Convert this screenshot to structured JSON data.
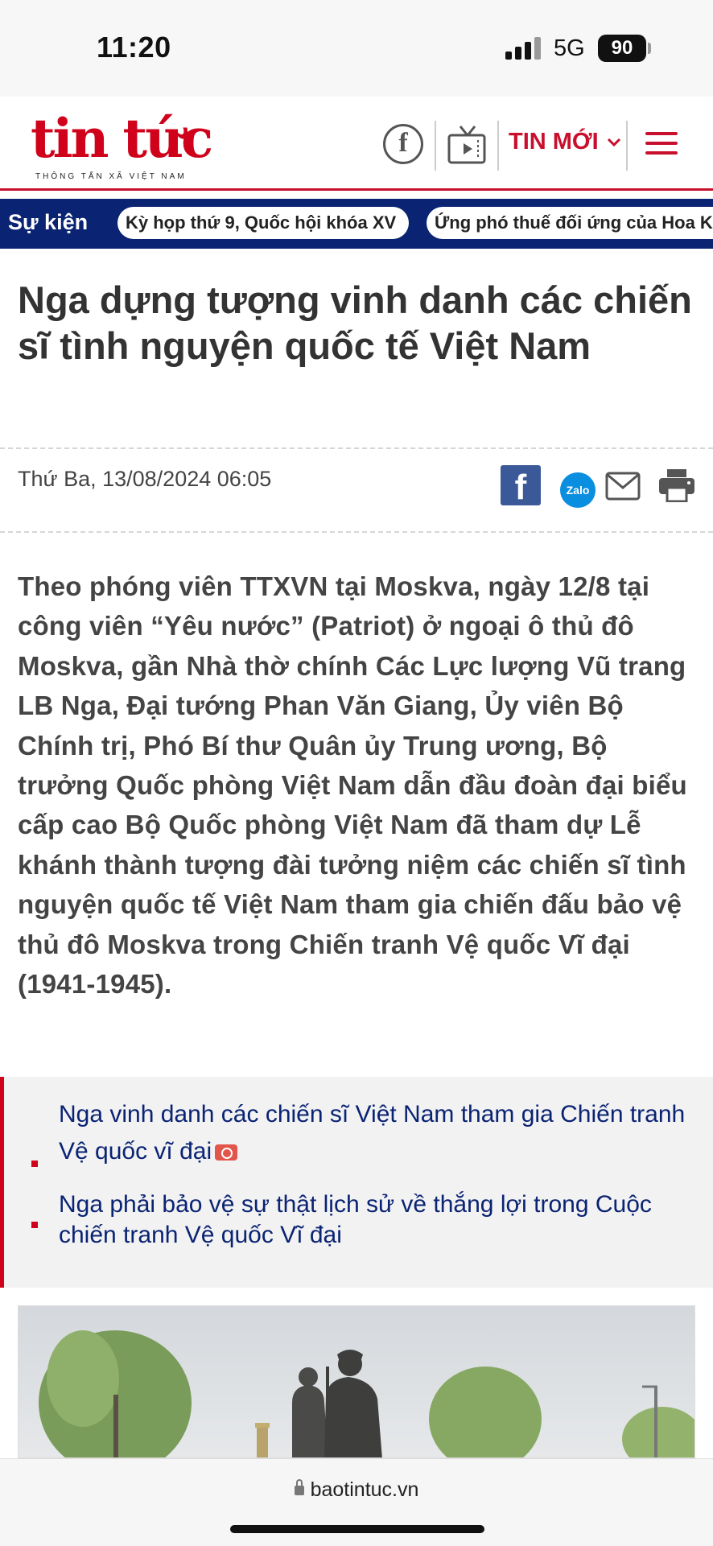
{
  "status_bar": {
    "time": "11:20",
    "network": "5G",
    "battery": "90"
  },
  "header": {
    "logo_text": "tin tức",
    "logo_subtitle": "THÔNG TẤN XÃ VIỆT NAM",
    "latest_label": "TIN MỚI",
    "icons": [
      "facebook-icon",
      "tv-icon",
      "chevron-down-icon",
      "menu-icon"
    ]
  },
  "event_bar": {
    "label": "Sự kiện",
    "items": [
      "Kỳ họp thứ 9, Quốc hội khóa XV",
      "Ứng phó thuế đối ứng của Hoa Kỳ"
    ]
  },
  "article": {
    "title": "Nga dựng tượng vinh danh các chiến sĩ tình nguyện quốc tế Việt Nam",
    "date": "Thứ Ba, 13/08/2024 06:05",
    "share_icons": [
      "facebook-share-icon",
      "zalo-share-icon",
      "mail-share-icon",
      "print-icon"
    ],
    "zalo_label": "Zalo",
    "lead": "Theo phóng viên TTXVN tại Moskva, ngày 12/8 tại công viên “Yêu nước” (Patriot) ở ngoại ô thủ đô Moskva, gần Nhà thờ chính Các Lực lượng Vũ trang LB Nga, Đại tướng Phan Văn Giang, Ủy viên Bộ Chính trị, Phó Bí thư Quân ủy Trung ương, Bộ trưởng Quốc phòng Việt Nam dẫn đầu đoàn đại biểu cấp cao Bộ Quốc phòng Việt Nam đã tham dự Lễ khánh thành tượng đài tưởng niệm các chiến sĩ tình nguyện quốc tế Việt Nam tham gia chiến đấu bảo vệ thủ đô Moskva trong Chiến tranh Vệ quốc Vĩ đại (1941-1945)."
  },
  "related": [
    {
      "text": "Nga vinh danh các chiến sĩ Việt Nam tham gia Chiến tranh Vệ quốc vĩ đại",
      "icon": "camera-icon"
    },
    {
      "text": "Nga phải bảo vệ sự thật lịch sử về thắng lợi trong Cuộc chiến tranh Vệ quốc Vĩ đại"
    }
  ],
  "browser": {
    "url": "baotintuc.vn"
  },
  "colors": {
    "brand_red": "#d0021b",
    "navy": "#0a2373",
    "facebook": "#3b5998",
    "zalo": "#0a8ee0"
  }
}
